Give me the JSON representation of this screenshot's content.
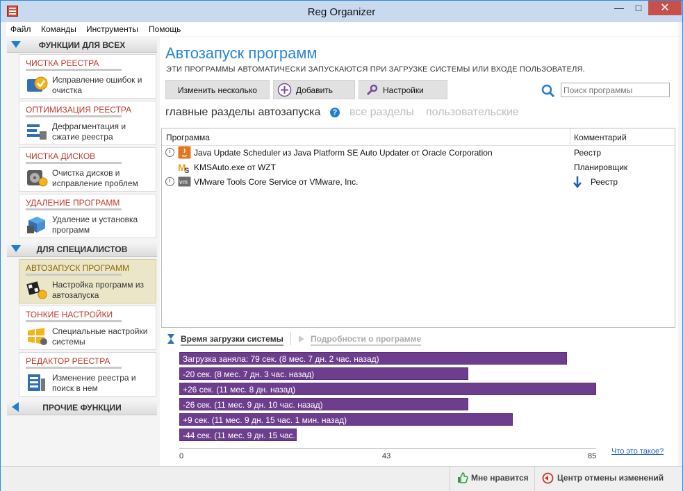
{
  "window": {
    "title": "Reg Organizer",
    "minimize": "—",
    "maximize": "□",
    "close": "✕"
  },
  "menu": [
    "Файл",
    "Команды",
    "Инструменты",
    "Помощь"
  ],
  "sidebar": {
    "section1": "ФУНКЦИИ ДЛЯ ВСЕХ",
    "section2": "ДЛЯ СПЕЦИАЛИСТОВ",
    "section3": "ПРОЧИЕ ФУНКЦИИ",
    "items": [
      {
        "title": "ЧИСТКА РЕЕСТРА",
        "desc": "Исправление ошибок и очистка",
        "icon": "registry-clean-icon"
      },
      {
        "title": "ОПТИМИЗАЦИЯ РЕЕСТРА",
        "desc": "Дефрагментация и сжатие реестра",
        "icon": "registry-optimize-icon"
      },
      {
        "title": "ЧИСТКА ДИСКОВ",
        "desc": "Очистка дисков и исправление проблем",
        "icon": "disk-clean-icon"
      },
      {
        "title": "УДАЛЕНИЕ ПРОГРАММ",
        "desc": "Удаление и установка программ",
        "icon": "uninstall-icon"
      },
      {
        "title": "АВТОЗАПУСК ПРОГРАММ",
        "desc": "Настройка программ из автозапуска",
        "icon": "autorun-icon",
        "active": true
      },
      {
        "title": "ТОНКИЕ НАСТРОЙКИ",
        "desc": "Специальные настройки системы",
        "icon": "tweaks-icon"
      },
      {
        "title": "РЕДАКТОР РЕЕСТРА",
        "desc": "Изменение реестра и поиск в нем",
        "icon": "registry-editor-icon"
      }
    ]
  },
  "main": {
    "title": "Автозапуск программ",
    "subtitle": "ЭТИ ПРОГРАММЫ АВТОМАТИЧЕСКИ ЗАПУСКАЮТСЯ ПРИ ЗАГРУЗКЕ СИСТЕМЫ ИЛИ ВХОДЕ ПОЛЬЗОВАТЕЛЯ.",
    "buttons": {
      "change_many": "Изменить несколько",
      "add": "Добавить",
      "settings": "Настройки"
    },
    "search_placeholder": "Поиск программы",
    "tabs": [
      "главные разделы автозапуска",
      "все разделы",
      "пользовательские"
    ],
    "table": {
      "col_program": "Программа",
      "col_comment": "Комментарий",
      "rows": [
        {
          "name": "Java Update Scheduler из Java Platform SE Auto Updater от Oracle Corporation",
          "comment": "Реестр",
          "icon": "java-icon",
          "clock": true,
          "arrow": false
        },
        {
          "name": "KMSAuto.exe от WZT",
          "comment": "Планировщик",
          "icon": "kmsauto-icon",
          "clock": false,
          "arrow": false
        },
        {
          "name": "VMware Tools Core Service от VMware, Inc.",
          "comment": "Реестр",
          "icon": "vmware-icon",
          "clock": true,
          "arrow": true
        }
      ]
    },
    "load_tabs": {
      "boot_time": "Время загрузки системы",
      "details": "Подробности о программе"
    },
    "boot_bars": [
      {
        "label": "Загрузка заняла: 79 сек. (8 мес. 7 дн. 2 час. назад)",
        "value": 79
      },
      {
        "label": "-20 сек. (8 мес. 7 дн. 3 час. назад)",
        "value": 59
      },
      {
        "label": "+26 сек. (11 мес. 8 дн. назад)",
        "value": 85
      },
      {
        "label": "-26 сек. (11 мес. 9 дн. 10 час. назад)",
        "value": 59
      },
      {
        "label": "+9 сек. (11 мес. 9 дн. 15 час. 1 мин. назад)",
        "value": 68
      },
      {
        "label": "-44 сек. (11 мес. 9 дн. 15 час. ...",
        "value": 24
      }
    ],
    "axis_ticks": [
      "0",
      "43",
      "85"
    ],
    "axis_max": 85,
    "what_is_it": "Что это такое?"
  },
  "statusbar": {
    "like": "Мне нравится",
    "undo_center": "Центр отмены изменений"
  },
  "colors": {
    "accent": "#2a86d6",
    "bar": "#6e3e8e",
    "tile_title": "#c0392b"
  }
}
